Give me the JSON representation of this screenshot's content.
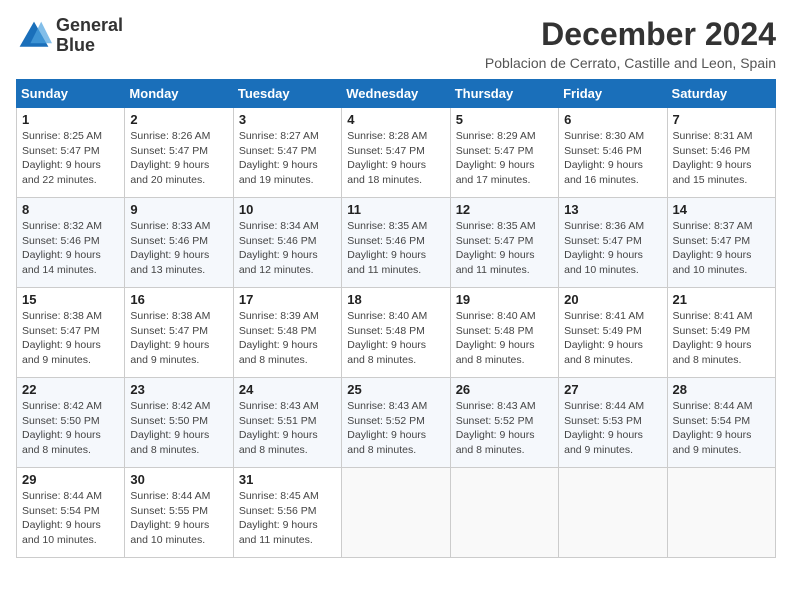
{
  "header": {
    "logo_line1": "General",
    "logo_line2": "Blue",
    "title": "December 2024",
    "subtitle": "Poblacion de Cerrato, Castille and Leon, Spain"
  },
  "weekdays": [
    "Sunday",
    "Monday",
    "Tuesday",
    "Wednesday",
    "Thursday",
    "Friday",
    "Saturday"
  ],
  "weeks": [
    [
      {
        "day": "1",
        "info": "Sunrise: 8:25 AM\nSunset: 5:47 PM\nDaylight: 9 hours\nand 22 minutes."
      },
      {
        "day": "2",
        "info": "Sunrise: 8:26 AM\nSunset: 5:47 PM\nDaylight: 9 hours\nand 20 minutes."
      },
      {
        "day": "3",
        "info": "Sunrise: 8:27 AM\nSunset: 5:47 PM\nDaylight: 9 hours\nand 19 minutes."
      },
      {
        "day": "4",
        "info": "Sunrise: 8:28 AM\nSunset: 5:47 PM\nDaylight: 9 hours\nand 18 minutes."
      },
      {
        "day": "5",
        "info": "Sunrise: 8:29 AM\nSunset: 5:47 PM\nDaylight: 9 hours\nand 17 minutes."
      },
      {
        "day": "6",
        "info": "Sunrise: 8:30 AM\nSunset: 5:46 PM\nDaylight: 9 hours\nand 16 minutes."
      },
      {
        "day": "7",
        "info": "Sunrise: 8:31 AM\nSunset: 5:46 PM\nDaylight: 9 hours\nand 15 minutes."
      }
    ],
    [
      {
        "day": "8",
        "info": "Sunrise: 8:32 AM\nSunset: 5:46 PM\nDaylight: 9 hours\nand 14 minutes."
      },
      {
        "day": "9",
        "info": "Sunrise: 8:33 AM\nSunset: 5:46 PM\nDaylight: 9 hours\nand 13 minutes."
      },
      {
        "day": "10",
        "info": "Sunrise: 8:34 AM\nSunset: 5:46 PM\nDaylight: 9 hours\nand 12 minutes."
      },
      {
        "day": "11",
        "info": "Sunrise: 8:35 AM\nSunset: 5:46 PM\nDaylight: 9 hours\nand 11 minutes."
      },
      {
        "day": "12",
        "info": "Sunrise: 8:35 AM\nSunset: 5:47 PM\nDaylight: 9 hours\nand 11 minutes."
      },
      {
        "day": "13",
        "info": "Sunrise: 8:36 AM\nSunset: 5:47 PM\nDaylight: 9 hours\nand 10 minutes."
      },
      {
        "day": "14",
        "info": "Sunrise: 8:37 AM\nSunset: 5:47 PM\nDaylight: 9 hours\nand 10 minutes."
      }
    ],
    [
      {
        "day": "15",
        "info": "Sunrise: 8:38 AM\nSunset: 5:47 PM\nDaylight: 9 hours\nand 9 minutes."
      },
      {
        "day": "16",
        "info": "Sunrise: 8:38 AM\nSunset: 5:47 PM\nDaylight: 9 hours\nand 9 minutes."
      },
      {
        "day": "17",
        "info": "Sunrise: 8:39 AM\nSunset: 5:48 PM\nDaylight: 9 hours\nand 8 minutes."
      },
      {
        "day": "18",
        "info": "Sunrise: 8:40 AM\nSunset: 5:48 PM\nDaylight: 9 hours\nand 8 minutes."
      },
      {
        "day": "19",
        "info": "Sunrise: 8:40 AM\nSunset: 5:48 PM\nDaylight: 9 hours\nand 8 minutes."
      },
      {
        "day": "20",
        "info": "Sunrise: 8:41 AM\nSunset: 5:49 PM\nDaylight: 9 hours\nand 8 minutes."
      },
      {
        "day": "21",
        "info": "Sunrise: 8:41 AM\nSunset: 5:49 PM\nDaylight: 9 hours\nand 8 minutes."
      }
    ],
    [
      {
        "day": "22",
        "info": "Sunrise: 8:42 AM\nSunset: 5:50 PM\nDaylight: 9 hours\nand 8 minutes."
      },
      {
        "day": "23",
        "info": "Sunrise: 8:42 AM\nSunset: 5:50 PM\nDaylight: 9 hours\nand 8 minutes."
      },
      {
        "day": "24",
        "info": "Sunrise: 8:43 AM\nSunset: 5:51 PM\nDaylight: 9 hours\nand 8 minutes."
      },
      {
        "day": "25",
        "info": "Sunrise: 8:43 AM\nSunset: 5:52 PM\nDaylight: 9 hours\nand 8 minutes."
      },
      {
        "day": "26",
        "info": "Sunrise: 8:43 AM\nSunset: 5:52 PM\nDaylight: 9 hours\nand 8 minutes."
      },
      {
        "day": "27",
        "info": "Sunrise: 8:44 AM\nSunset: 5:53 PM\nDaylight: 9 hours\nand 9 minutes."
      },
      {
        "day": "28",
        "info": "Sunrise: 8:44 AM\nSunset: 5:54 PM\nDaylight: 9 hours\nand 9 minutes."
      }
    ],
    [
      {
        "day": "29",
        "info": "Sunrise: 8:44 AM\nSunset: 5:54 PM\nDaylight: 9 hours\nand 10 minutes."
      },
      {
        "day": "30",
        "info": "Sunrise: 8:44 AM\nSunset: 5:55 PM\nDaylight: 9 hours\nand 10 minutes."
      },
      {
        "day": "31",
        "info": "Sunrise: 8:45 AM\nSunset: 5:56 PM\nDaylight: 9 hours\nand 11 minutes."
      },
      {
        "day": "",
        "info": ""
      },
      {
        "day": "",
        "info": ""
      },
      {
        "day": "",
        "info": ""
      },
      {
        "day": "",
        "info": ""
      }
    ]
  ]
}
